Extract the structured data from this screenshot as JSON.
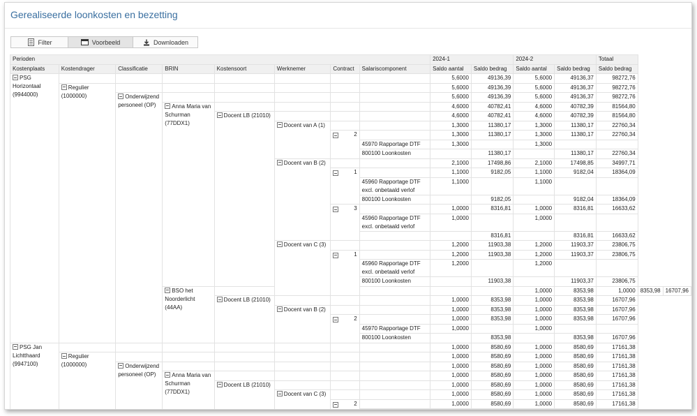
{
  "page_title": "Gerealiseerde loonkosten en bezetting",
  "toolbar": {
    "filter": "Filter",
    "preview": "Voorbeeld",
    "download": "Downloaden"
  },
  "table": {
    "perioden": "Perioden",
    "period_2024_1": "2024-1",
    "period_2024_2": "2024-2",
    "totaal": "Totaal",
    "headers": {
      "kostenplaats": "Kostenplaats",
      "kostendrager": "Kostendrager",
      "classificatie": "Classificatie",
      "brin": "BRIN",
      "kostensoort": "Kostensoort",
      "werknemer": "Werknemer",
      "contract": "Contract",
      "salariscomponent": "Salariscomponent",
      "saldo_aantal": "Saldo aantal",
      "saldo_bedrag": "Saldo bedrag"
    },
    "labels": {
      "psg_horizontaal": "PSG Horizontaal (9944000)",
      "regulier": "Regulier (1000000)",
      "onderwijzend": "Onderwijzend personeel (OP)",
      "anna": "Anna Maria van Schurman (77DDX1)",
      "docent_lb": "Docent LB (21010)",
      "docent_a1": "Docent van A (1)",
      "docent_b2": "Docent van B (2)",
      "docent_c3": "Docent van C (3)",
      "bso": "BSO het Noorderlicht (44AA)",
      "psg_jan": "PSG Jan Lichtthaard (9947100)",
      "c1": "1",
      "c2": "2",
      "c3": "3",
      "sc_45970": "45970 Rapportage DTF",
      "sc_45960": "45960 Rapportage DTF excl. onbetaald verlof",
      "sc_800100": "800100 Loonkosten"
    },
    "v": {
      "a56": "5,6000",
      "b491": "49136,39",
      "b4937": "49136,37",
      "t9827": "98272,76",
      "a46": "4,6000",
      "b4078": "40782,41",
      "b4078b": "40782,39",
      "t8156": "81564,80",
      "a13": "1,3000",
      "b1138": "11380,17",
      "t2276": "22760,34",
      "a21": "2,1000",
      "b1749a": "17498,86",
      "b1749b": "17498,85",
      "t3499": "34997,71",
      "a11": "1,1000",
      "b9182a": "9182,05",
      "b9182b": "9182,04",
      "t1836": "18364,09",
      "a10": "1,0000",
      "b8316a": "8316,81",
      "b8316b": "8316,81",
      "t1663": "16633,62",
      "a12": "1,2000",
      "b1190a": "11903,38",
      "b1190b": "11903,37",
      "t2380": "23806,75",
      "b8353": "8353,98",
      "t1670": "16707,96",
      "b8580": "8580,69",
      "t1716": "17161,38"
    }
  }
}
